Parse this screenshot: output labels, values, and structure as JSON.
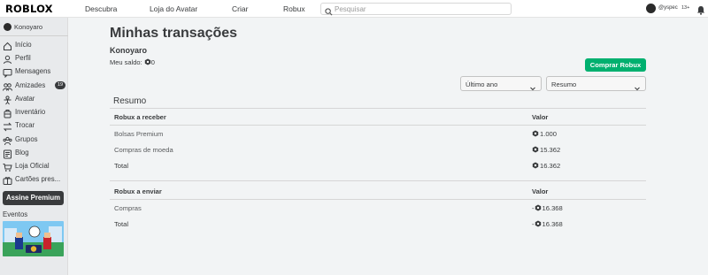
{
  "topbar": {
    "logo": "ROBLOX",
    "nav": [
      "Descubra",
      "Loja do Avatar",
      "Criar",
      "Robux"
    ],
    "search_placeholder": "Pesquisar",
    "username": "@yspec",
    "age_label": "13+"
  },
  "sidebar": {
    "user": "Konoyaro",
    "items": [
      {
        "label": "Início",
        "icon": "home-icon"
      },
      {
        "label": "Perfil",
        "icon": "profile-icon"
      },
      {
        "label": "Mensagens",
        "icon": "messages-icon"
      },
      {
        "label": "Amizades",
        "icon": "friends-icon",
        "badge": "19"
      },
      {
        "label": "Avatar",
        "icon": "avatar-icon"
      },
      {
        "label": "Inventário",
        "icon": "inventory-icon"
      },
      {
        "label": "Trocar",
        "icon": "trade-icon"
      },
      {
        "label": "Grupos",
        "icon": "groups-icon"
      },
      {
        "label": "Blog",
        "icon": "blog-icon"
      },
      {
        "label": "Loja Oficial",
        "icon": "shop-icon"
      },
      {
        "label": "Cartões pres...",
        "icon": "gift-card-icon"
      }
    ],
    "premium_button": "Assine Premium",
    "events_label": "Eventos"
  },
  "main": {
    "title": "Minhas transações",
    "account_name": "Konoyaro",
    "balance_label": "Meu saldo:",
    "balance_value": "0",
    "buy_button": "Comprar Robux",
    "period_select": "Último ano",
    "type_select": "Resumo",
    "summary_heading": "Resumo",
    "incoming": {
      "header": "Robux a receber",
      "value_header": "Valor",
      "rows": [
        {
          "label": "Bolsas Premium",
          "value": "1.000"
        },
        {
          "label": "Compras de moeda",
          "value": "15.362"
        },
        {
          "label": "Total",
          "value": "16.362"
        }
      ]
    },
    "outgoing": {
      "header": "Robux a enviar",
      "value_header": "Valor",
      "rows": [
        {
          "label": "Compras",
          "value": "16.368",
          "prefix": "-"
        },
        {
          "label": "Total",
          "value": "16.368",
          "prefix": "-"
        }
      ]
    }
  },
  "colors": {
    "accent_green": "#00b06f",
    "dark": "#393b3d",
    "background": "#f2f4f5"
  }
}
